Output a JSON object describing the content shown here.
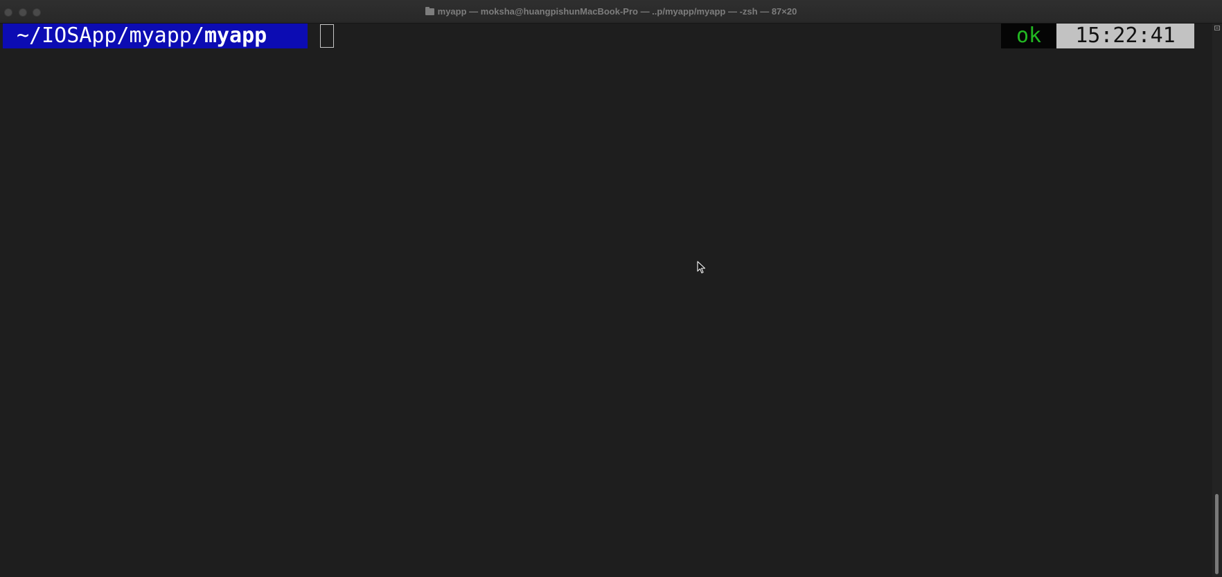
{
  "window": {
    "title": "myapp — moksha@huangpishunMacBook-Pro — ..p/myapp/myapp — -zsh — 87×20",
    "title_icon": "folder-icon"
  },
  "prompt": {
    "path_prefix": "~/IOSApp/myapp/",
    "path_current": "myapp",
    "path_bg_color": "#0c0cb3"
  },
  "status": {
    "ok": "ok",
    "ok_color": "#22b822",
    "time": "15:22:41"
  },
  "colors": {
    "terminal_bg": "#1e1e1e"
  }
}
